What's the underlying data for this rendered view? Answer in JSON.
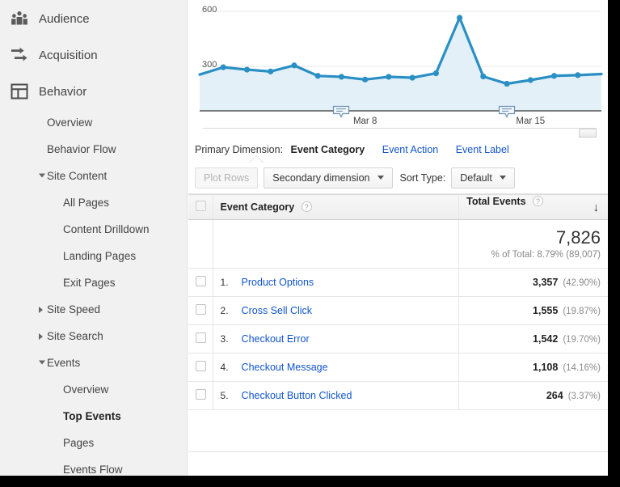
{
  "sidebar": {
    "top_items": [
      {
        "label": "Audience",
        "icon": "audience-people-icon"
      },
      {
        "label": "Acquisition",
        "icon": "acquisition-arrows-icon"
      },
      {
        "label": "Behavior",
        "icon": "behavior-layout-icon"
      }
    ],
    "behavior_children": [
      {
        "label": "Overview",
        "level": 2,
        "expandable": false,
        "expanded": false,
        "selected": false
      },
      {
        "label": "Behavior Flow",
        "level": 2,
        "expandable": false,
        "expanded": false,
        "selected": false
      },
      {
        "label": "Site Content",
        "level": 2,
        "expandable": true,
        "expanded": true,
        "selected": false
      },
      {
        "label": "All Pages",
        "level": 3,
        "expandable": false,
        "expanded": false,
        "selected": false
      },
      {
        "label": "Content Drilldown",
        "level": 3,
        "expandable": false,
        "expanded": false,
        "selected": false
      },
      {
        "label": "Landing Pages",
        "level": 3,
        "expandable": false,
        "expanded": false,
        "selected": false
      },
      {
        "label": "Exit Pages",
        "level": 3,
        "expandable": false,
        "expanded": false,
        "selected": false
      },
      {
        "label": "Site Speed",
        "level": 2,
        "expandable": true,
        "expanded": false,
        "selected": false
      },
      {
        "label": "Site Search",
        "level": 2,
        "expandable": true,
        "expanded": false,
        "selected": false
      },
      {
        "label": "Events",
        "level": 2,
        "expandable": true,
        "expanded": true,
        "selected": false
      },
      {
        "label": "Overview",
        "level": 3,
        "expandable": false,
        "expanded": false,
        "selected": false
      },
      {
        "label": "Top Events",
        "level": 3,
        "expandable": false,
        "expanded": false,
        "selected": true
      },
      {
        "label": "Pages",
        "level": 3,
        "expandable": false,
        "expanded": false,
        "selected": false
      },
      {
        "label": "Events Flow",
        "level": 3,
        "expandable": false,
        "expanded": false,
        "selected": false
      }
    ]
  },
  "chart_data": {
    "type": "line",
    "title": "",
    "xlabel": "",
    "ylabel": "",
    "ylim": [
      0,
      680
    ],
    "yticks": [
      300,
      600
    ],
    "ytick_labels": [
      "300",
      "600"
    ],
    "grid": true,
    "legend_position": "none",
    "line_color": "#2a8fc4",
    "area_color": "#e3f0f8",
    "x": [
      "Mar 1",
      "Mar 2",
      "Mar 3",
      "Mar 4",
      "Mar 5",
      "Mar 6",
      "Mar 7",
      "Mar 8",
      "Mar 9",
      "Mar 10",
      "Mar 11",
      "Mar 12",
      "Mar 13",
      "Mar 14",
      "Mar 15",
      "Mar 16",
      "Mar 17",
      "Mar 18"
    ],
    "xtick_labels": [
      "Mar 8",
      "Mar 15"
    ],
    "values": [
      255,
      295,
      282,
      272,
      305,
      248,
      243,
      228,
      243,
      238,
      262,
      565,
      245,
      205,
      225,
      248,
      252,
      258
    ],
    "annotations": [
      {
        "label": "annotation-marker",
        "x_index": 6
      },
      {
        "label": "annotation-marker",
        "x_index": 13
      }
    ]
  },
  "primary_dimension": {
    "label": "Primary Dimension:",
    "active": "Event Category",
    "links": [
      "Event Action",
      "Event Label"
    ]
  },
  "toolbar": {
    "plot_rows": "Plot Rows",
    "secondary_dimension": "Secondary dimension",
    "sort_type_label": "Sort Type:",
    "sort_type_value": "Default"
  },
  "table": {
    "columns": {
      "name": "Event Category",
      "total": "Total Events"
    },
    "summary": {
      "total": "7,826",
      "subtitle": "% of Total: 8.79% (89,007)"
    },
    "rows": [
      {
        "index": "1.",
        "name": "Product Options",
        "value": "3,357",
        "pct": "(42.90%)"
      },
      {
        "index": "2.",
        "name": "Cross Sell Click",
        "value": "1,555",
        "pct": "(19.87%)"
      },
      {
        "index": "3.",
        "name": "Checkout Error",
        "value": "1,542",
        "pct": "(19.70%)"
      },
      {
        "index": "4.",
        "name": "Checkout Message",
        "value": "1,108",
        "pct": "(14.16%)"
      },
      {
        "index": "5.",
        "name": "Checkout Button Clicked",
        "value": "264",
        "pct": "(3.37%)"
      }
    ],
    "sort_arrow": "↓"
  },
  "colors": {
    "link": "#1155cc",
    "chart_line": "#2a8fc4",
    "chart_fill": "#e3f0f8",
    "sidebar_bg": "#f1f1f1"
  }
}
